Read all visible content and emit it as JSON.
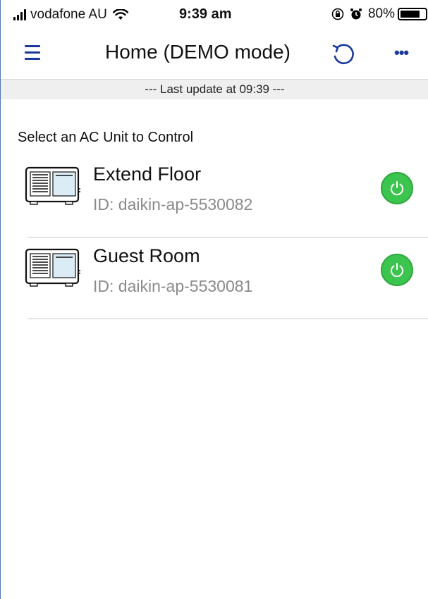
{
  "status_bar": {
    "carrier": "vodafone AU",
    "time": "9:39 am",
    "battery_percent": "80%",
    "battery_level": 0.8
  },
  "nav": {
    "title": "Home (DEMO mode)",
    "menu_icon": "hamburger-menu-icon",
    "refresh_icon": "refresh-icon",
    "more_icon": "more-dots-icon",
    "more_label": "•••"
  },
  "update_bar": {
    "text": "--- Last update at 09:39 ---"
  },
  "section_label": "Select an  AC Unit to Control",
  "units": [
    {
      "name": "Extend Floor",
      "id": "ID: daikin-ap-5530082",
      "power_on": true
    },
    {
      "name": "Guest Room",
      "id": "ID: daikin-ap-5530081",
      "power_on": true
    }
  ],
  "colors": {
    "accent": "#1b3a9b",
    "power_green": "#3bc44e",
    "update_bar_bg": "#efefef",
    "ac_panel_light": "#dcecf6"
  }
}
